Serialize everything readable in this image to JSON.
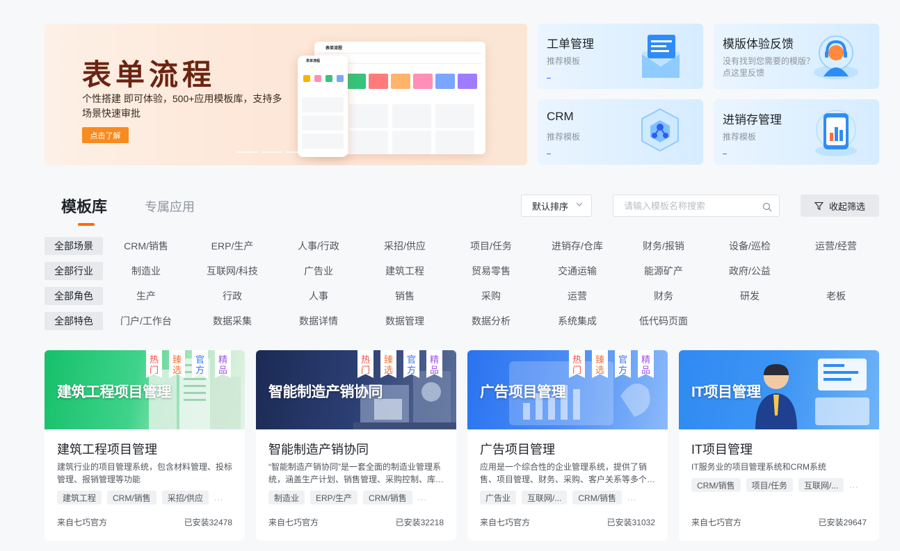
{
  "banner": {
    "title": "表单流程",
    "desc": "个性搭建 即可体验，500+应用模板库，支持多场景快速审批",
    "cta": "点击了解",
    "mock_title": "表单流程"
  },
  "feature_cards": [
    {
      "title": "工单管理",
      "sub": "推荐模板",
      "icon": "envelope-card-icon"
    },
    {
      "title": "模版体验反馈",
      "sub": "没有找到您需要的模版？点这里反馈",
      "icon": "support-headset-icon"
    },
    {
      "title": "CRM",
      "sub": "推荐模板",
      "icon": "network-cube-icon"
    },
    {
      "title": "进销存管理",
      "sub": "推荐模板",
      "icon": "bar-chart-phone-icon"
    }
  ],
  "tabs": {
    "active": "模板库",
    "other": "专属应用"
  },
  "sort": {
    "label": "默认排序"
  },
  "search": {
    "placeholder": "请输入模板名称搜索"
  },
  "filter_button": "收起筛选",
  "filters": [
    {
      "all": "全部场景",
      "items": [
        "CRM/销售",
        "ERP/生产",
        "人事/行政",
        "采招/供应",
        "项目/任务",
        "进销存/仓库",
        "财务/报销",
        "设备/巡检",
        "运营/经营"
      ]
    },
    {
      "all": "全部行业",
      "items": [
        "制造业",
        "互联网/科技",
        "广告业",
        "建筑工程",
        "贸易零售",
        "交通运输",
        "能源矿产",
        "政府/公益"
      ]
    },
    {
      "all": "全部角色",
      "items": [
        "生产",
        "行政",
        "人事",
        "销售",
        "采购",
        "运营",
        "财务",
        "研发",
        "老板"
      ]
    },
    {
      "all": "全部特色",
      "items": [
        "门户/工作台",
        "数据采集",
        "数据详情",
        "数据管理",
        "数据分析",
        "系统集成",
        "低代码页面"
      ]
    }
  ],
  "ribbon_labels": {
    "hot": "热门",
    "sel": "臻选",
    "off": "官方",
    "fine": "精品"
  },
  "templates": [
    {
      "thumb_title": "建筑工程项目管理",
      "name": "建筑工程项目管理",
      "desc": "建筑行业的项目管理系统，包含材料管理、投标管理、报销管理等功能",
      "tags": [
        "建筑工程",
        "CRM/销售",
        "采招/供应"
      ],
      "more": "...",
      "source": "来自七巧官方",
      "installs": "已安装32478",
      "ribbons": true,
      "theme": "#1fbf6a"
    },
    {
      "thumb_title": "智能制造产销协同",
      "name": "智能制造产销协同",
      "desc": "“智能制造产销协同”是一套全面的制造业管理系统，涵盖生产计划、销售管理、采购控制、库存管理等",
      "tags": [
        "制造业",
        "ERP/生产",
        "CRM/销售"
      ],
      "more": "...",
      "source": "来自七巧官方",
      "installs": "已安装32218",
      "ribbons": true,
      "theme": "#2a3a66"
    },
    {
      "thumb_title": "广告项目管理",
      "name": "广告项目管理",
      "desc": "应用是一个综合性的企业管理系统，提供了销售、项目管理、财务、采购、客户关系等多个模块",
      "tags": [
        "广告业",
        "互联网/...",
        "CRM/销售"
      ],
      "more": "...",
      "source": "来自七巧官方",
      "installs": "已安装31032",
      "ribbons": true,
      "theme": "#2f7bf0"
    },
    {
      "thumb_title": "IT项目管理",
      "name": "IT项目管理",
      "desc": "IT服务业的项目管理系统和CRM系统",
      "tags": [
        "CRM/销售",
        "项目/任务",
        "互联网/..."
      ],
      "more": "...",
      "source": "来自七巧官方",
      "installs": "已安装29647",
      "ribbons": false,
      "theme": "#2f86f0"
    }
  ]
}
